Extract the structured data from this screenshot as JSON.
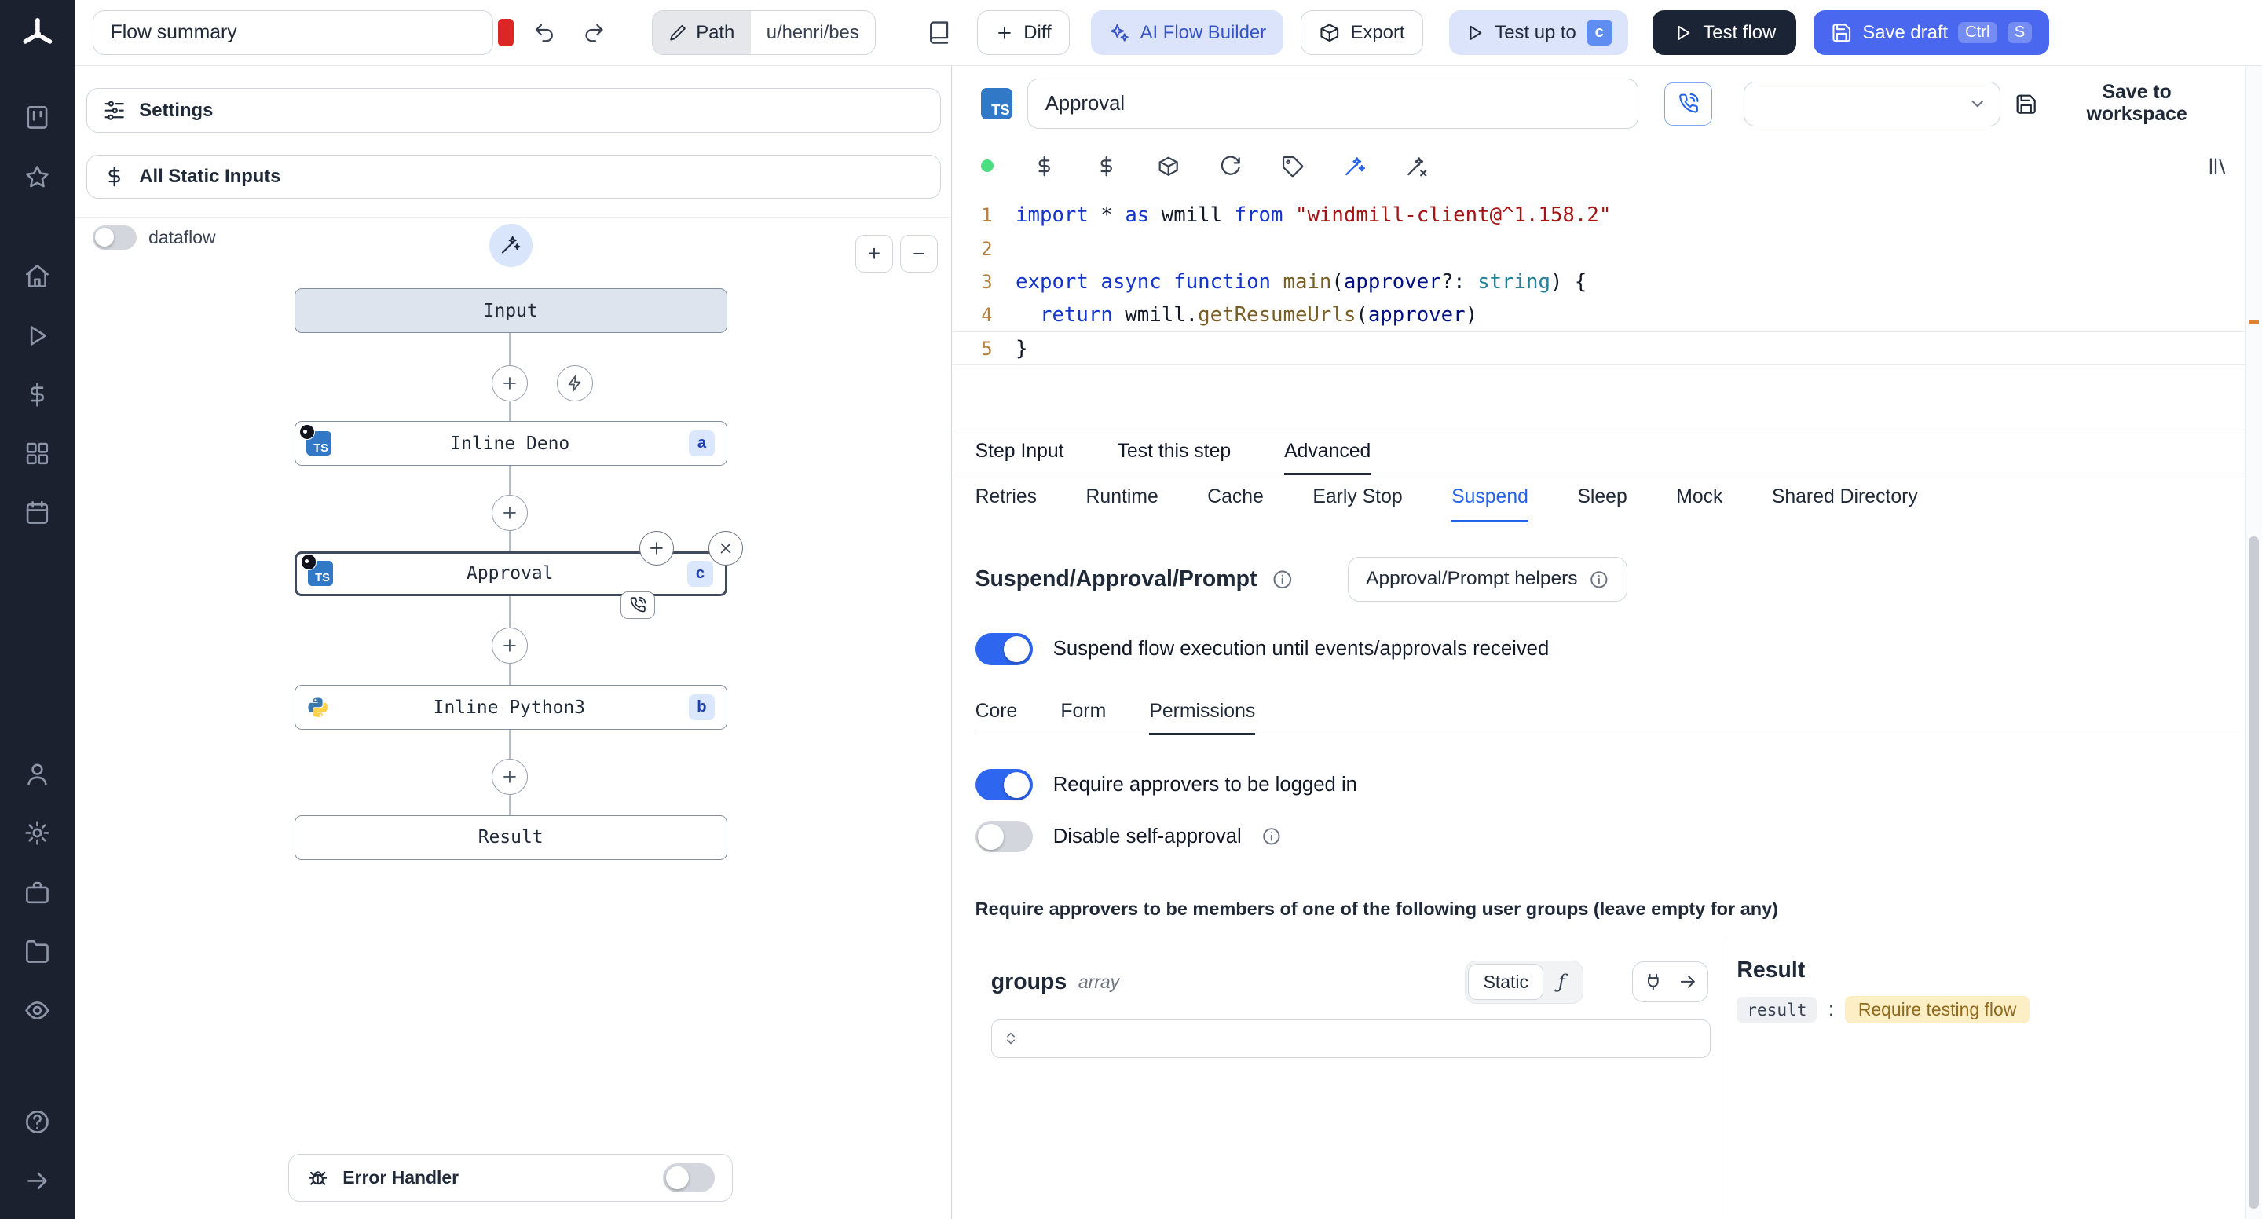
{
  "sidebar": {
    "icons_top": [
      "kanban",
      "star"
    ],
    "icons_mid": [
      "home",
      "play",
      "dollar",
      "grid",
      "calendar"
    ],
    "icons_lower": [
      "user",
      "gear",
      "briefcase",
      "folder",
      "eye"
    ],
    "icons_footer": [
      "help",
      "arrow-right"
    ]
  },
  "topbar": {
    "flow_summary": "Flow summary",
    "path_label": "Path",
    "path_value": "u/henri/bes",
    "diff_label": "Diff",
    "ai_flow_builder_label": "AI Flow Builder",
    "export_label": "Export",
    "test_up_to_label": "Test up to",
    "test_up_to_badge": "c",
    "test_flow_label": "Test flow",
    "save_draft_label": "Save draft",
    "save_draft_shortcut": [
      "Ctrl",
      "S"
    ]
  },
  "flow_panel": {
    "settings_label": "Settings",
    "all_static_inputs_label": "All Static Inputs",
    "dataflow_label": "dataflow",
    "dataflow_enabled": false,
    "zoom_in": "+",
    "zoom_out": "−",
    "nodes": {
      "input_label": "Input",
      "steps": [
        {
          "label": "Inline Deno",
          "badge": "a",
          "language": "typescript"
        },
        {
          "label": "Approval",
          "badge": "c",
          "language": "typescript",
          "selected": true
        },
        {
          "label": "Inline Python3",
          "badge": "b",
          "language": "python"
        }
      ],
      "result_label": "Result"
    },
    "error_handler_label": "Error Handler",
    "error_handler_enabled": false
  },
  "step_editor": {
    "name_value": "Approval",
    "language_badge": "TS",
    "save_to_workspace_label": "Save to workspace",
    "code": {
      "lines": [
        {
          "n": "1",
          "tokens": [
            [
              "kw",
              "import"
            ],
            [
              "pl",
              " * "
            ],
            [
              "kw",
              "as"
            ],
            [
              "pl",
              " wmill "
            ],
            [
              "kw",
              "from"
            ],
            [
              "pl",
              " "
            ],
            [
              "str",
              "\"windmill-client@^1.158.2\""
            ]
          ]
        },
        {
          "n": "2",
          "tokens": []
        },
        {
          "n": "3",
          "tokens": [
            [
              "kw",
              "export"
            ],
            [
              "pl",
              " "
            ],
            [
              "kw",
              "async"
            ],
            [
              "pl",
              " "
            ],
            [
              "kw",
              "function"
            ],
            [
              "pl",
              " "
            ],
            [
              "fn",
              "main"
            ],
            [
              "pl",
              "("
            ],
            [
              "vr",
              "approver"
            ],
            [
              "pl",
              "?: "
            ],
            [
              "ty",
              "string"
            ],
            [
              "pl",
              ") {"
            ]
          ]
        },
        {
          "n": "4",
          "tokens": [
            [
              "pl",
              "  "
            ],
            [
              "kw",
              "return"
            ],
            [
              "pl",
              " wmill."
            ],
            [
              "fn",
              "getResumeUrls"
            ],
            [
              "pl",
              "("
            ],
            [
              "vr",
              "approver"
            ],
            [
              "pl",
              ")"
            ]
          ]
        },
        {
          "n": "5",
          "tokens": [
            [
              "pl",
              "}"
            ]
          ],
          "current": true
        }
      ]
    }
  },
  "tabs": {
    "main": [
      "Step Input",
      "Test this step",
      "Advanced"
    ],
    "main_active": "Advanced",
    "advanced": [
      "Retries",
      "Runtime",
      "Cache",
      "Early Stop",
      "Suspend",
      "Sleep",
      "Mock",
      "Shared Directory"
    ],
    "advanced_active": "Suspend"
  },
  "suspend_section": {
    "title": "Suspend/Approval/Prompt",
    "helpers_button_label": "Approval/Prompt helpers",
    "suspend_toggle_label": "Suspend flow execution until events/approvals received",
    "suspend_enabled": true,
    "tabs": [
      "Core",
      "Form",
      "Permissions"
    ],
    "tabs_active": "Permissions",
    "require_login_label": "Require approvers to be logged in",
    "require_login_enabled": true,
    "disable_self_approval_label": "Disable self-approval",
    "disable_self_approval_enabled": false,
    "groups_note": "Require approvers to be members of one of the following user groups (leave empty for any)",
    "groups_field": {
      "name": "groups",
      "type": "array",
      "mode_label": "Static",
      "fn_glyph": "ƒ",
      "value": ""
    }
  },
  "result_panel": {
    "title": "Result",
    "key": "result",
    "colon": ":",
    "value": "Require testing flow"
  }
}
